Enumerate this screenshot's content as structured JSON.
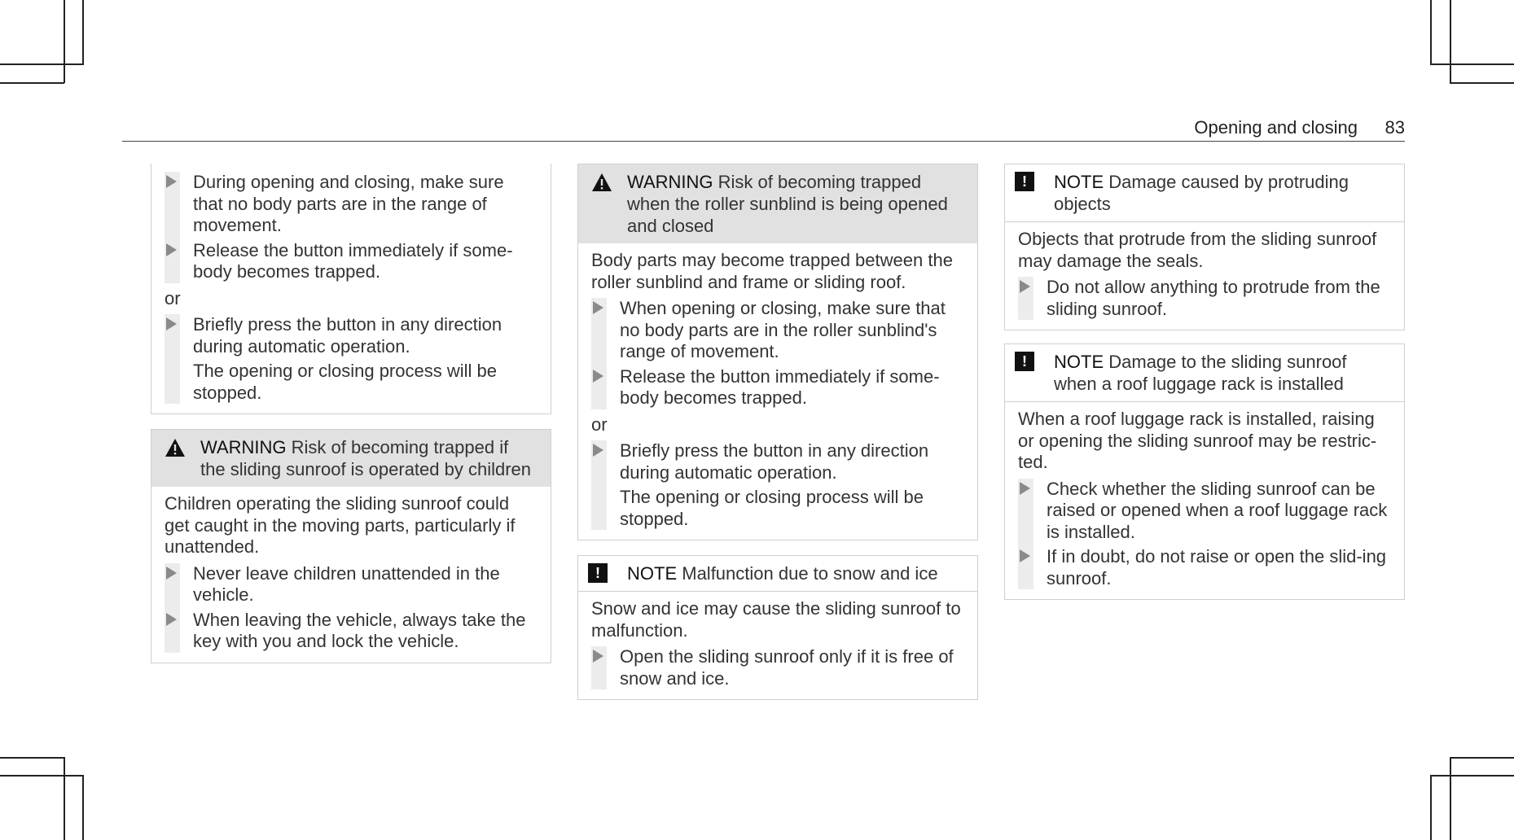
{
  "header": {
    "section": "Opening and closing",
    "page_number": "83"
  },
  "col1": {
    "cont_steps_a": [
      "During opening and closing, make sure that no body parts are in the range of movement.",
      "Release the button immediately if some-body becomes trapped."
    ],
    "or_label": "or",
    "cont_steps_b": [
      "Briefly press the button in any direction during automatic operation."
    ],
    "cont_result": "The opening or closing process will be stopped.",
    "warning_children": {
      "keyword": "WARNING",
      "title": "Risk of becoming trapped if the sliding sunroof is operated by children",
      "body": "Children operating the sliding sunroof could get caught in the moving parts, particularly if unattended.",
      "steps": [
        "Never leave children unattended in the vehicle.",
        "When leaving the vehicle, always take the key with you and lock the vehicle."
      ]
    }
  },
  "col2": {
    "warning_sunblind": {
      "keyword": "WARNING",
      "title": "Risk of becoming trapped when the roller sunblind is being opened and closed",
      "body": "Body parts may become trapped between the roller sunblind and frame or sliding roof.",
      "steps_a": [
        "When opening or closing, make sure that no body parts are in the roller sunblind's range of movement.",
        "Release the button immediately if some-body becomes trapped."
      ],
      "or_label": "or",
      "steps_b": [
        "Briefly press the button in any direction during automatic operation."
      ],
      "result": "The opening or closing process will be stopped."
    },
    "note_snow": {
      "keyword": "NOTE",
      "title": "Malfunction due to snow and ice",
      "body": "Snow and ice may cause the sliding sunroof to malfunction.",
      "steps": [
        "Open the sliding sunroof only if it is free of snow and ice."
      ]
    }
  },
  "col3": {
    "note_protruding": {
      "keyword": "NOTE",
      "title": "Damage caused by protruding objects",
      "body": "Objects that protrude from the sliding sunroof may damage the seals.",
      "steps": [
        "Do not allow anything to protrude from the sliding sunroof."
      ]
    },
    "note_luggage": {
      "keyword": "NOTE",
      "title": "Damage to the sliding sunroof when a roof luggage rack is installed",
      "body": "When a roof luggage rack is installed, raising or opening the sliding sunroof may be restric-ted.",
      "steps": [
        "Check whether the sliding sunroof can be raised or opened when a roof luggage rack is installed.",
        "If in doubt, do not raise or open the slid-ing sunroof."
      ]
    }
  },
  "icons": {
    "warning": "warning-triangle-icon",
    "note": "exclamation-note-icon",
    "step": "step-arrow-icon"
  },
  "colors": {
    "warning_header_bg": "#e1e1e1",
    "box_border": "#cfcfcf",
    "step_bar": "#ececec"
  }
}
